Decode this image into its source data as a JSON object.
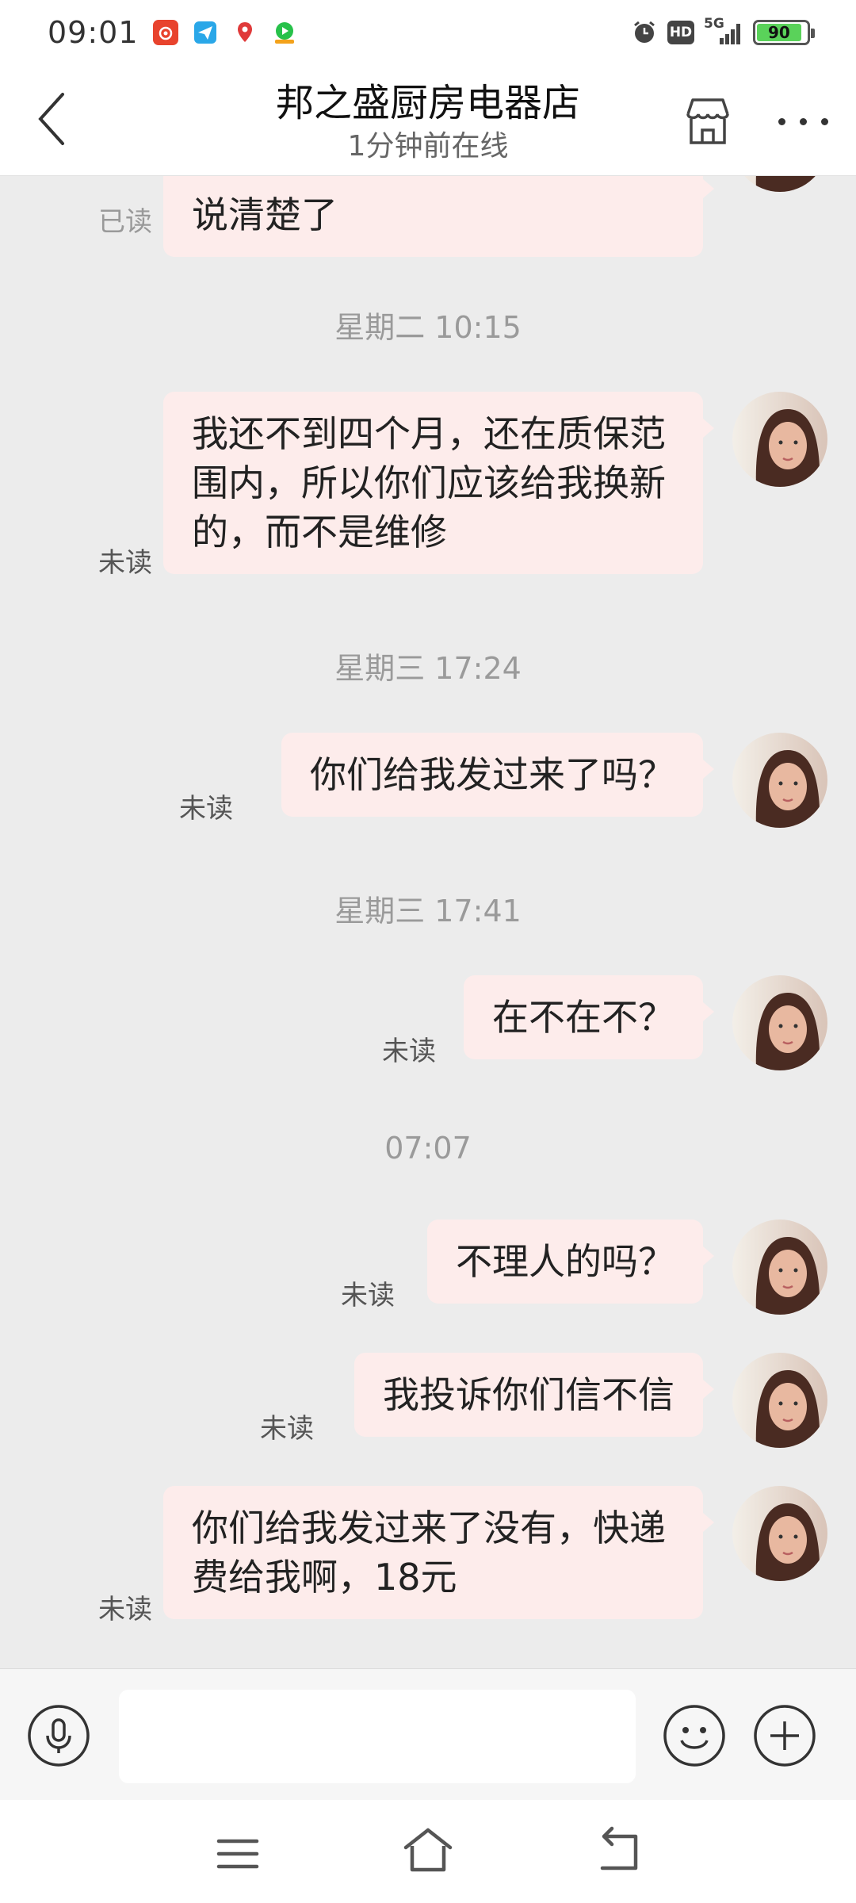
{
  "status_bar": {
    "time": "09:01",
    "notifications": [
      "weibo-icon",
      "paper-plane-icon",
      "map-pin-icon",
      "video-app-icon"
    ],
    "hd_label": "HD",
    "network_label": "5G",
    "battery_level": "90",
    "battery_fraction": 0.9
  },
  "header": {
    "title": "邦之盛厨房电器店",
    "subtitle": "1分钟前在线"
  },
  "messages": [
    {
      "text": "说清楚了",
      "status": "已读"
    },
    {
      "time": "星期二 10:15"
    },
    {
      "text": "我还不到四个月，还在质保范围内，所以你们应该给我换新的，而不是维修",
      "status": "未读"
    },
    {
      "time": "星期三 17:24"
    },
    {
      "text": "你们给我发过来了吗？",
      "status": "未读"
    },
    {
      "time": "星期三 17:41"
    },
    {
      "text": "在不在不？",
      "status": "未读"
    },
    {
      "time": "07:07"
    },
    {
      "text": "不理人的吗？",
      "status": "未读"
    },
    {
      "text": "我投诉你们信不信",
      "status": "未读"
    },
    {
      "text": "你们给我发过来了没有，快递费给我啊，18元",
      "status": "未读"
    }
  ],
  "input": {
    "value": "",
    "placeholder": ""
  },
  "colors": {
    "bubble": "#fdeceb",
    "chat_background": "#ececec",
    "header_background": "#ffffff"
  }
}
